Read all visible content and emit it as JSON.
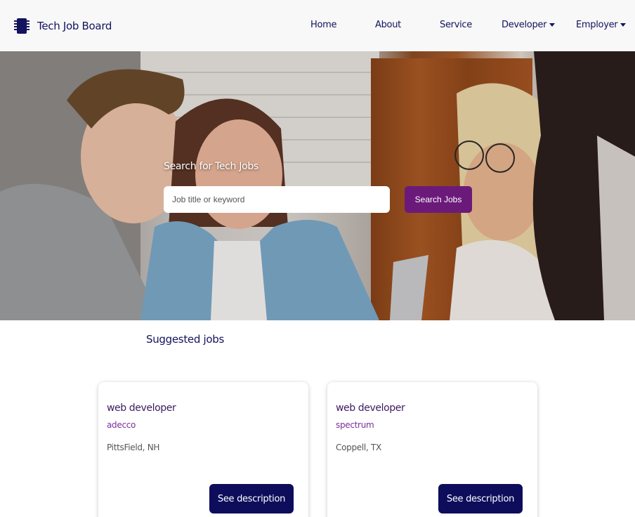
{
  "brand": {
    "name": "Tech Job Board",
    "icon": "chip-icon"
  },
  "nav": {
    "home": "Home",
    "about": "About",
    "service": "Service",
    "developer": "Developer",
    "employer": "Employer"
  },
  "hero": {
    "title": "Search for Tech Jobs",
    "search_placeholder": "Job title or keyword",
    "search_button": "Search Jobs"
  },
  "suggested": {
    "title": "Suggested jobs",
    "jobs": [
      {
        "title": "web developer",
        "company": "adecco",
        "location": "PittsField, NH",
        "button": "See description"
      },
      {
        "title": "web developer",
        "company": "spectrum",
        "location": "Coppell, TX",
        "button": "See description"
      }
    ]
  },
  "colors": {
    "brand_navy": "#13135e",
    "search_button": "#6b1a7a",
    "description_button": "#0d0d5c",
    "company_purple": "#7a2f9a"
  }
}
